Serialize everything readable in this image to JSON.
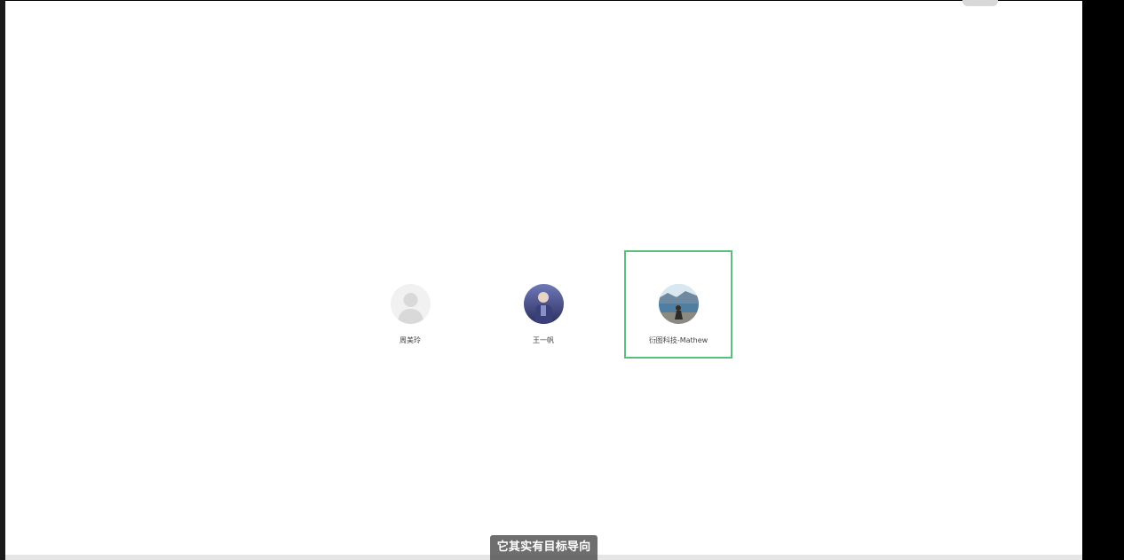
{
  "accounts": [
    {
      "name": "周美玲",
      "avatar": "default-person-avatar",
      "selected": false
    },
    {
      "name": "王一帆",
      "avatar": "user-photo-avatar",
      "selected": false
    },
    {
      "name": "衍图科技-Mathew",
      "avatar": "user-photo-avatar",
      "selected": true
    }
  ],
  "caption": {
    "text": "它其实有目标导向"
  },
  "colors": {
    "selection_border": "#5bbf7c",
    "caption_background": "#5a5a5a",
    "page_background": "#ffffff"
  }
}
